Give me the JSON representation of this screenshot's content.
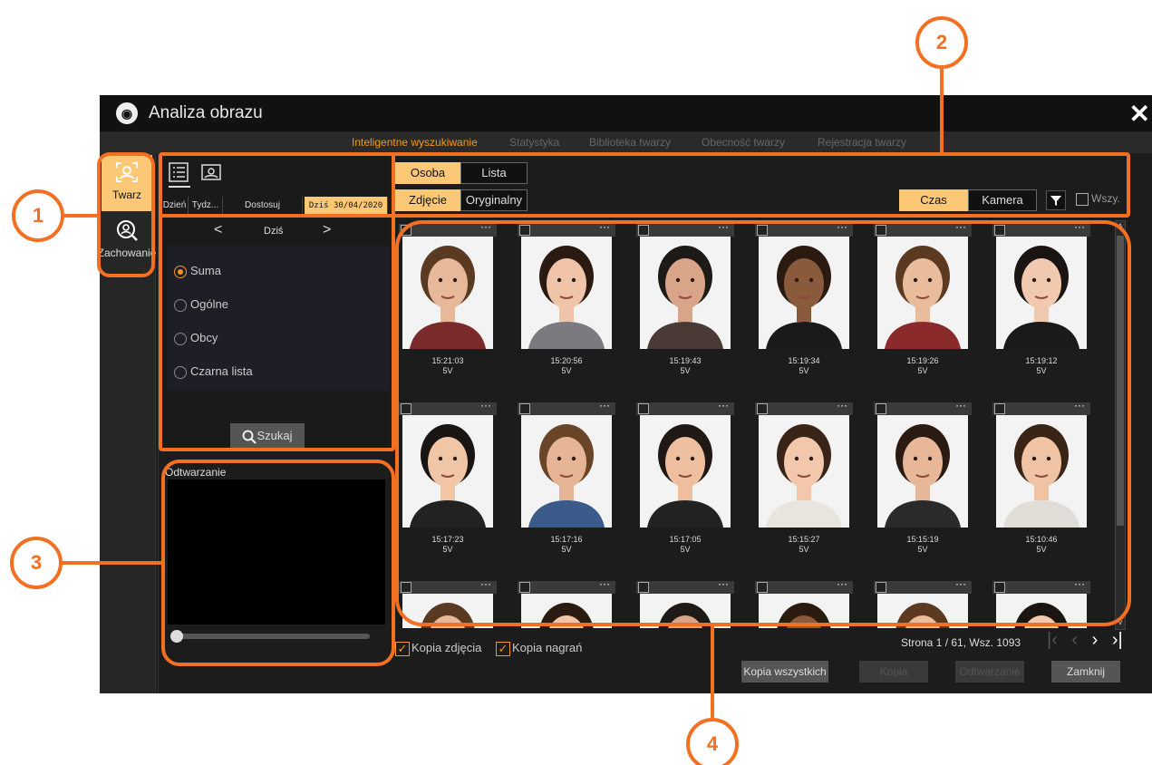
{
  "window": {
    "title": "Analiza obrazu",
    "close_icon": "close-icon"
  },
  "tabs": [
    {
      "label": "Inteligentne wyszukiwanie",
      "active": true
    },
    {
      "label": "Statystyka",
      "active": false
    },
    {
      "label": "Biblioteka twarzy",
      "active": false
    },
    {
      "label": "Obecność twarzy",
      "active": false
    },
    {
      "label": "Rejestracja twarzy",
      "active": false
    }
  ],
  "sidebar": {
    "items": [
      {
        "label": "Twarz",
        "icon": "face-scan-icon",
        "active": true
      },
      {
        "label": "Zachowanie",
        "icon": "person-search-icon",
        "active": false
      }
    ]
  },
  "left_panel": {
    "view_icons": [
      "list-view-icon",
      "image-view-icon"
    ],
    "date_filters": [
      "Dzień",
      "Tydz...",
      "Dostosuj",
      "Dziś 30/04/2020"
    ],
    "day_nav": {
      "prev": "<",
      "label": "Dziś",
      "next": ">"
    },
    "radios": [
      {
        "label": "Suma",
        "selected": true
      },
      {
        "label": "Ogólne",
        "selected": false
      },
      {
        "label": "Obcy",
        "selected": false
      },
      {
        "label": "Czarna lista",
        "selected": false
      }
    ],
    "search_label": "Szukaj"
  },
  "playback": {
    "label": "Odtwarzanie",
    "progress": 0
  },
  "toolbar": {
    "mode": [
      "Osoba",
      "Lista"
    ],
    "source": [
      "Zdjęcie",
      "Oryginalny"
    ],
    "sort": [
      "Czas",
      "Kamera"
    ],
    "all_label": "Wszy.",
    "filter_icon": "filter-icon"
  },
  "results": [
    {
      "time": "15:21:03",
      "cam": "5V"
    },
    {
      "time": "15:20:56",
      "cam": "5V"
    },
    {
      "time": "15:19:43",
      "cam": "5V"
    },
    {
      "time": "15:19:34",
      "cam": "5V"
    },
    {
      "time": "15:19:26",
      "cam": "5V"
    },
    {
      "time": "15:19:12",
      "cam": "5V"
    },
    {
      "time": "15:17:23",
      "cam": "5V"
    },
    {
      "time": "15:17:16",
      "cam": "5V"
    },
    {
      "time": "15:17:05",
      "cam": "5V"
    },
    {
      "time": "15:15:27",
      "cam": "5V"
    },
    {
      "time": "15:15:19",
      "cam": "5V"
    },
    {
      "time": "15:10:46",
      "cam": "5V"
    }
  ],
  "copy_options": {
    "photo": "Kopia zdjęcia",
    "recordings": "Kopia nagrań"
  },
  "pagination": {
    "text": "Strona 1 / 61, Wsz. 1093"
  },
  "actions": {
    "copy_all": "Kopia wszystkich",
    "copy": "Kopia",
    "play": "Odtwarzanie",
    "close": "Zamknij"
  },
  "annotations": [
    "1",
    "2",
    "3",
    "4"
  ],
  "colors": {
    "accent": "#f39a1c",
    "annotation": "#f36f21",
    "active_bg": "#fcc875"
  }
}
